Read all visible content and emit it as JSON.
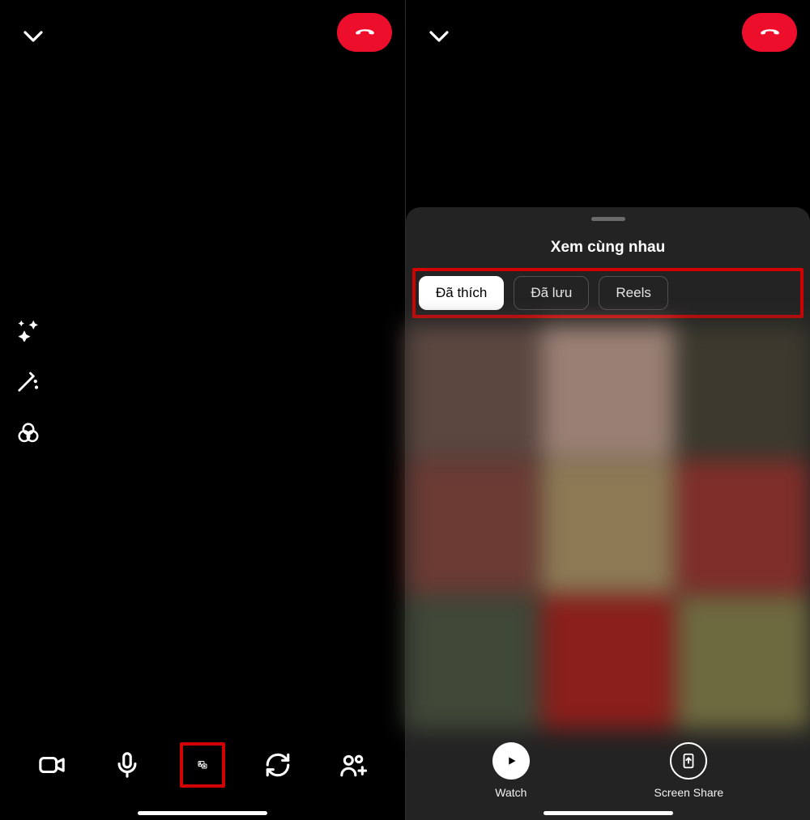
{
  "left": {
    "hangup_icon": "hangup",
    "bottom": {
      "camera": "camera",
      "mic": "mic",
      "media": "media",
      "rotate": "rotate",
      "people": "people"
    }
  },
  "right": {
    "sheet_title": "Xem cùng nhau",
    "tabs": {
      "liked": "Đã thích",
      "saved": "Đã lưu",
      "reels": "Reels"
    },
    "actions": {
      "watch": "Watch",
      "screen_share": "Screen Share"
    }
  }
}
